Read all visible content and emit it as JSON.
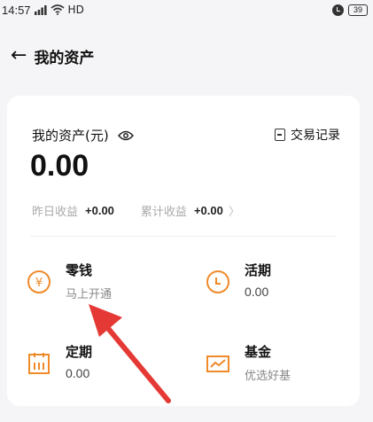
{
  "status_bar": {
    "time": "14:57",
    "network": "HD",
    "battery": "39"
  },
  "nav": {
    "title": "我的资产"
  },
  "asset_card": {
    "label": "我的资产(元)",
    "amount": "0.00",
    "trade_record_label": "交易记录",
    "yesterday_income_label": "昨日收益",
    "yesterday_income_value": "+0.00",
    "total_income_label": "累计收益",
    "total_income_value": "+0.00"
  },
  "products": [
    {
      "title": "零钱",
      "sub": "马上开通",
      "icon": "yuan-coin-icon"
    },
    {
      "title": "活期",
      "sub": "0.00",
      "icon": "clock-circle-icon"
    },
    {
      "title": "定期",
      "sub": "0.00",
      "icon": "calendar-icon"
    },
    {
      "title": "基金",
      "sub": "优选好基",
      "icon": "trend-chart-icon"
    }
  ],
  "colors": {
    "accent_orange": "#f08a2a",
    "arrow_red": "#e53935",
    "page_background": "#f5f5f7"
  }
}
